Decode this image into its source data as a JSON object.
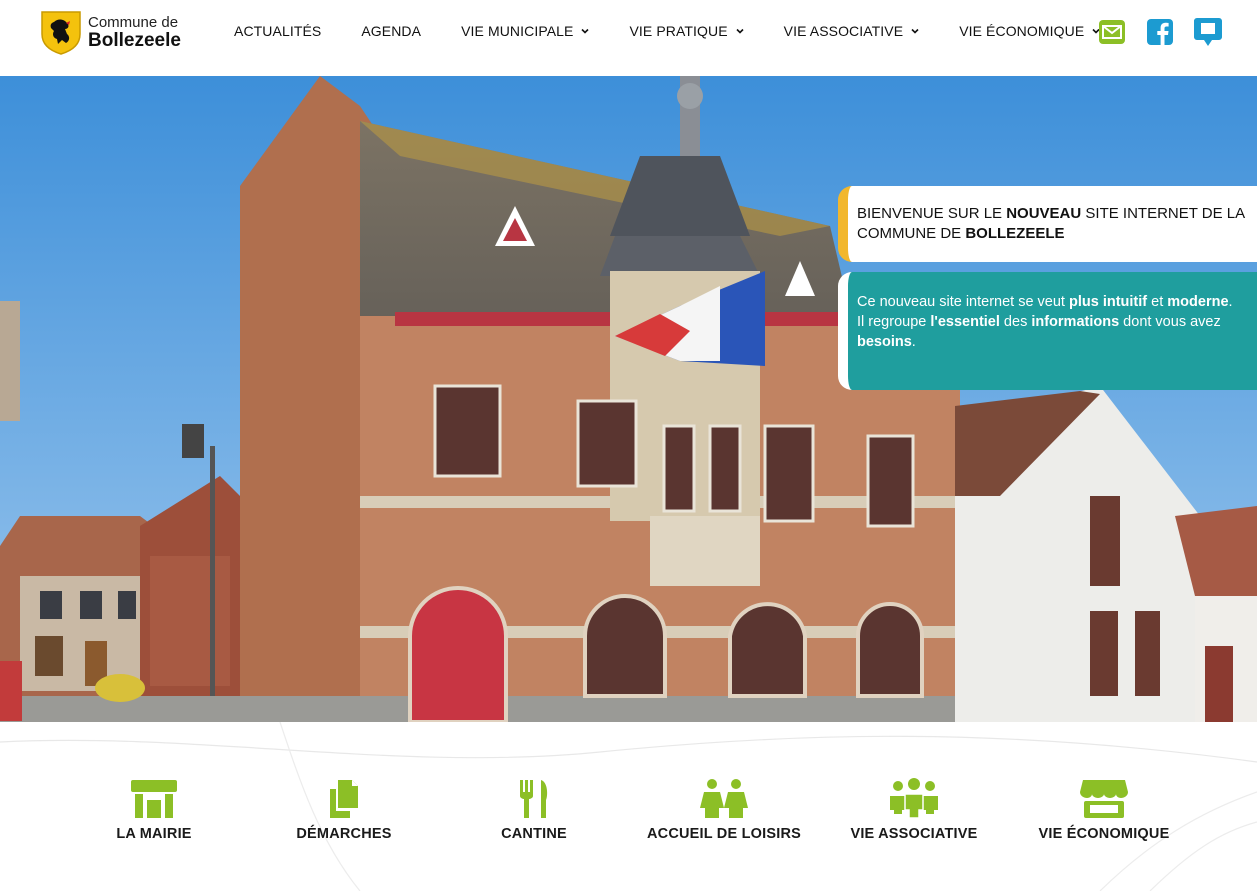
{
  "colors": {
    "accent_green": "#8cbf26",
    "accent_blue": "#1c9bd1",
    "teal": "#1f9e9e",
    "yellow": "#f2b72d"
  },
  "header": {
    "logo": {
      "line1": "Commune de",
      "line2": "Bollezeele"
    },
    "nav": [
      {
        "label": "ACTUALITÉS",
        "dropdown": false
      },
      {
        "label": "AGENDA",
        "dropdown": false
      },
      {
        "label": "VIE MUNICIPALE",
        "dropdown": true
      },
      {
        "label": "VIE PRATIQUE",
        "dropdown": true
      },
      {
        "label": "VIE ASSOCIATIVE",
        "dropdown": true
      },
      {
        "label": "VIE ÉCONOMIQUE",
        "dropdown": true
      }
    ],
    "icons": [
      "envelope-icon",
      "facebook-icon",
      "chat-bubble-icon"
    ]
  },
  "hero": {
    "welcome": {
      "p1": "BIENVENUE SUR LE ",
      "b1": "NOUVEAU",
      "p2": " SITE INTERNET DE LA COMMUNE DE ",
      "b2": "BOLLEZEELE"
    },
    "info": {
      "t1": "Ce nouveau site internet se veut ",
      "b1": "plus intuitif",
      "t2": " et ",
      "b2": "moderne",
      "t3": ".",
      "t4": "Il regroupe ",
      "b3": "l'essentiel",
      "t5": " des ",
      "b4": "informations",
      "t6": " dont vous avez ",
      "b5": "besoins",
      "t7": "."
    }
  },
  "quicklinks": [
    {
      "label": "LA MAIRIE",
      "icon": "town-hall-icon"
    },
    {
      "label": "DÉMARCHES",
      "icon": "documents-icon"
    },
    {
      "label": "CANTINE",
      "icon": "fork-knife-icon"
    },
    {
      "label": "ACCUEIL DE LOISIRS",
      "icon": "children-icon"
    },
    {
      "label": "VIE ASSOCIATIVE",
      "icon": "group-icon"
    },
    {
      "label": "VIE ÉCONOMIQUE",
      "icon": "shop-icon"
    }
  ]
}
